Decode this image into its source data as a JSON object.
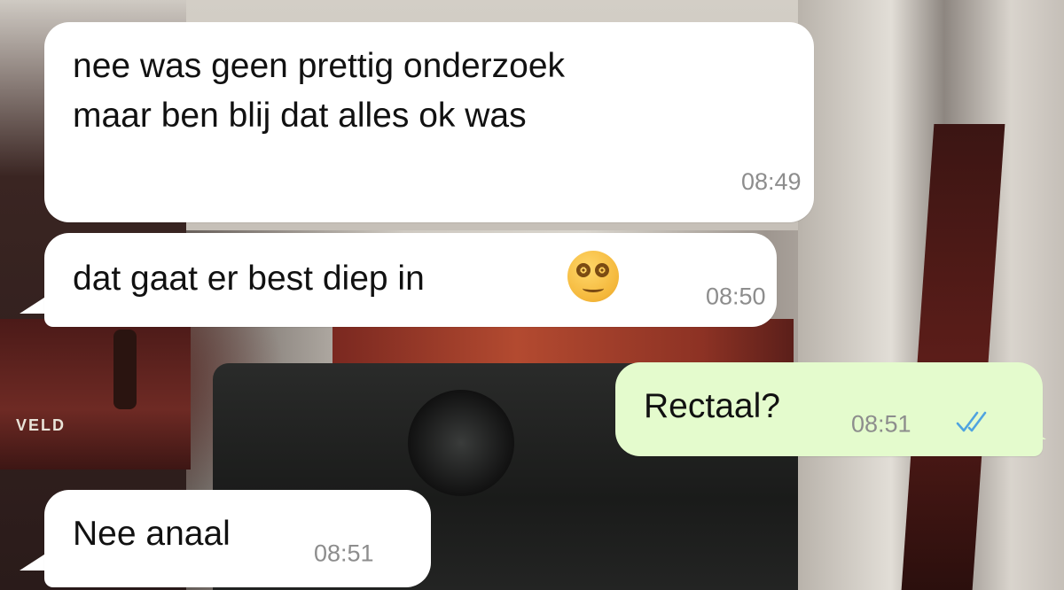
{
  "background": {
    "jersey_text": "VELD"
  },
  "messages": [
    {
      "direction": "incoming",
      "lines": [
        "nee was geen prettig onderzoek",
        "maar ben blij dat alles ok was"
      ],
      "time": "08:49"
    },
    {
      "direction": "incoming",
      "text": "dat gaat er best diep in",
      "emoji": "dizzy-face-emoji",
      "time": "08:50"
    },
    {
      "direction": "outgoing",
      "text": "Rectaal?",
      "time": "08:51",
      "status_icon": "double-check-icon",
      "status_color": "#4fa3e0"
    },
    {
      "direction": "incoming",
      "text": "Nee anaal",
      "time": "08:51"
    }
  ],
  "colors": {
    "incoming_bubble": "#ffffff",
    "outgoing_bubble": "#e4fbcd",
    "timestamp": "#8d8d8d"
  }
}
